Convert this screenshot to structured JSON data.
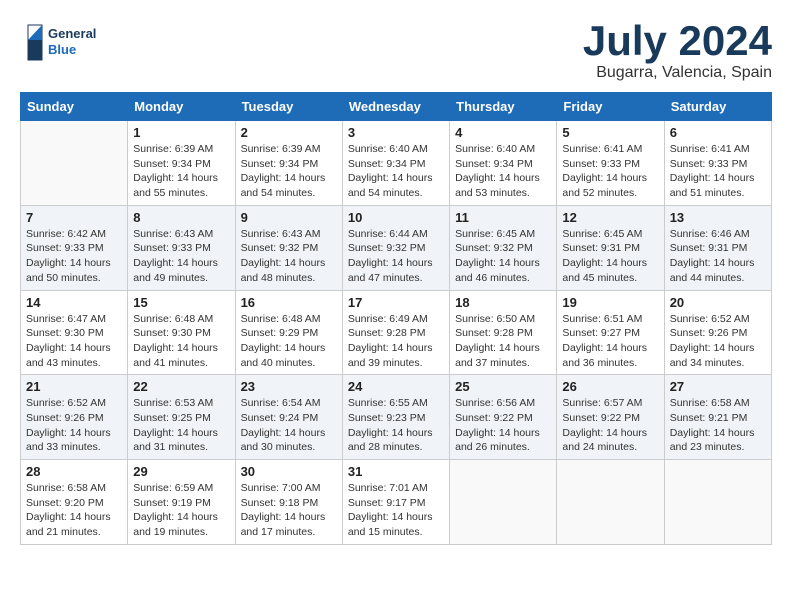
{
  "header": {
    "logo_line1": "General",
    "logo_line2": "Blue",
    "title": "July 2024",
    "subtitle": "Bugarra, Valencia, Spain"
  },
  "calendar": {
    "days_of_week": [
      "Sunday",
      "Monday",
      "Tuesday",
      "Wednesday",
      "Thursday",
      "Friday",
      "Saturday"
    ],
    "weeks": [
      [
        {
          "day": "",
          "info": ""
        },
        {
          "day": "1",
          "info": "Sunrise: 6:39 AM\nSunset: 9:34 PM\nDaylight: 14 hours\nand 55 minutes."
        },
        {
          "day": "2",
          "info": "Sunrise: 6:39 AM\nSunset: 9:34 PM\nDaylight: 14 hours\nand 54 minutes."
        },
        {
          "day": "3",
          "info": "Sunrise: 6:40 AM\nSunset: 9:34 PM\nDaylight: 14 hours\nand 54 minutes."
        },
        {
          "day": "4",
          "info": "Sunrise: 6:40 AM\nSunset: 9:34 PM\nDaylight: 14 hours\nand 53 minutes."
        },
        {
          "day": "5",
          "info": "Sunrise: 6:41 AM\nSunset: 9:33 PM\nDaylight: 14 hours\nand 52 minutes."
        },
        {
          "day": "6",
          "info": "Sunrise: 6:41 AM\nSunset: 9:33 PM\nDaylight: 14 hours\nand 51 minutes."
        }
      ],
      [
        {
          "day": "7",
          "info": "Sunrise: 6:42 AM\nSunset: 9:33 PM\nDaylight: 14 hours\nand 50 minutes."
        },
        {
          "day": "8",
          "info": "Sunrise: 6:43 AM\nSunset: 9:33 PM\nDaylight: 14 hours\nand 49 minutes."
        },
        {
          "day": "9",
          "info": "Sunrise: 6:43 AM\nSunset: 9:32 PM\nDaylight: 14 hours\nand 48 minutes."
        },
        {
          "day": "10",
          "info": "Sunrise: 6:44 AM\nSunset: 9:32 PM\nDaylight: 14 hours\nand 47 minutes."
        },
        {
          "day": "11",
          "info": "Sunrise: 6:45 AM\nSunset: 9:32 PM\nDaylight: 14 hours\nand 46 minutes."
        },
        {
          "day": "12",
          "info": "Sunrise: 6:45 AM\nSunset: 9:31 PM\nDaylight: 14 hours\nand 45 minutes."
        },
        {
          "day": "13",
          "info": "Sunrise: 6:46 AM\nSunset: 9:31 PM\nDaylight: 14 hours\nand 44 minutes."
        }
      ],
      [
        {
          "day": "14",
          "info": "Sunrise: 6:47 AM\nSunset: 9:30 PM\nDaylight: 14 hours\nand 43 minutes."
        },
        {
          "day": "15",
          "info": "Sunrise: 6:48 AM\nSunset: 9:30 PM\nDaylight: 14 hours\nand 41 minutes."
        },
        {
          "day": "16",
          "info": "Sunrise: 6:48 AM\nSunset: 9:29 PM\nDaylight: 14 hours\nand 40 minutes."
        },
        {
          "day": "17",
          "info": "Sunrise: 6:49 AM\nSunset: 9:28 PM\nDaylight: 14 hours\nand 39 minutes."
        },
        {
          "day": "18",
          "info": "Sunrise: 6:50 AM\nSunset: 9:28 PM\nDaylight: 14 hours\nand 37 minutes."
        },
        {
          "day": "19",
          "info": "Sunrise: 6:51 AM\nSunset: 9:27 PM\nDaylight: 14 hours\nand 36 minutes."
        },
        {
          "day": "20",
          "info": "Sunrise: 6:52 AM\nSunset: 9:26 PM\nDaylight: 14 hours\nand 34 minutes."
        }
      ],
      [
        {
          "day": "21",
          "info": "Sunrise: 6:52 AM\nSunset: 9:26 PM\nDaylight: 14 hours\nand 33 minutes."
        },
        {
          "day": "22",
          "info": "Sunrise: 6:53 AM\nSunset: 9:25 PM\nDaylight: 14 hours\nand 31 minutes."
        },
        {
          "day": "23",
          "info": "Sunrise: 6:54 AM\nSunset: 9:24 PM\nDaylight: 14 hours\nand 30 minutes."
        },
        {
          "day": "24",
          "info": "Sunrise: 6:55 AM\nSunset: 9:23 PM\nDaylight: 14 hours\nand 28 minutes."
        },
        {
          "day": "25",
          "info": "Sunrise: 6:56 AM\nSunset: 9:22 PM\nDaylight: 14 hours\nand 26 minutes."
        },
        {
          "day": "26",
          "info": "Sunrise: 6:57 AM\nSunset: 9:22 PM\nDaylight: 14 hours\nand 24 minutes."
        },
        {
          "day": "27",
          "info": "Sunrise: 6:58 AM\nSunset: 9:21 PM\nDaylight: 14 hours\nand 23 minutes."
        }
      ],
      [
        {
          "day": "28",
          "info": "Sunrise: 6:58 AM\nSunset: 9:20 PM\nDaylight: 14 hours\nand 21 minutes."
        },
        {
          "day": "29",
          "info": "Sunrise: 6:59 AM\nSunset: 9:19 PM\nDaylight: 14 hours\nand 19 minutes."
        },
        {
          "day": "30",
          "info": "Sunrise: 7:00 AM\nSunset: 9:18 PM\nDaylight: 14 hours\nand 17 minutes."
        },
        {
          "day": "31",
          "info": "Sunrise: 7:01 AM\nSunset: 9:17 PM\nDaylight: 14 hours\nand 15 minutes."
        },
        {
          "day": "",
          "info": ""
        },
        {
          "day": "",
          "info": ""
        },
        {
          "day": "",
          "info": ""
        }
      ]
    ]
  }
}
